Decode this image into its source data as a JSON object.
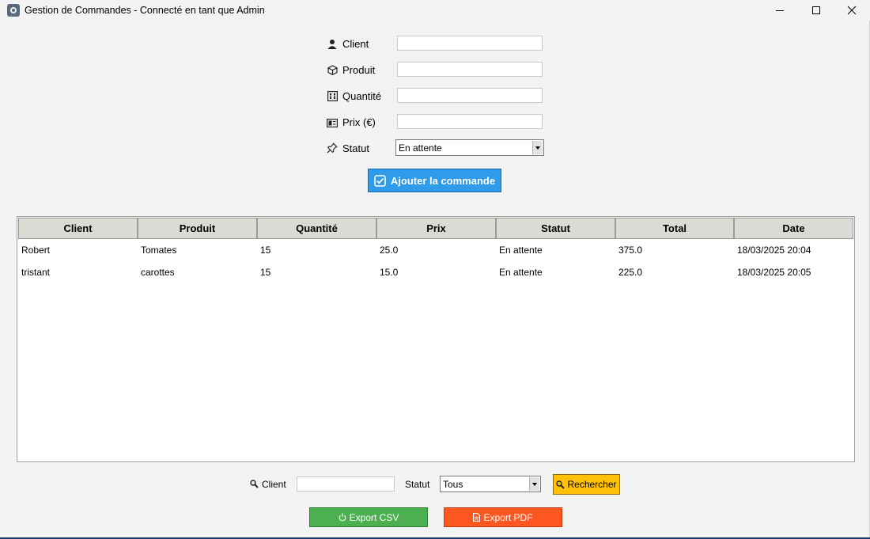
{
  "window": {
    "title": "Gestion de Commandes - Connecté en tant que Admin",
    "controls": [
      "minimize-icon",
      "maximize-icon",
      "close-icon"
    ]
  },
  "form": {
    "fields": [
      {
        "label": "Client",
        "icon": "person-icon",
        "value": ""
      },
      {
        "label": "Produit",
        "icon": "package-icon",
        "value": ""
      },
      {
        "label": "Quantité",
        "icon": "abacus-icon",
        "value": ""
      },
      {
        "label": "Prix (€)",
        "icon": "money-icon",
        "value": ""
      }
    ],
    "status": {
      "label": "Statut",
      "icon": "pushpin-icon",
      "selected": "En attente"
    },
    "add_button": {
      "label": "Ajouter la commande",
      "icon": "checkbox-icon"
    }
  },
  "table": {
    "columns": [
      "Client",
      "Produit",
      "Quantité",
      "Prix",
      "Statut",
      "Total",
      "Date"
    ],
    "rows": [
      [
        "Robert",
        "Tomates",
        "15",
        "25.0",
        "En attente",
        "375.0",
        "18/03/2025 20:04"
      ],
      [
        "tristant",
        "carottes",
        "15",
        "15.0",
        "En attente",
        "225.0",
        "18/03/2025 20:05"
      ]
    ]
  },
  "search": {
    "client_label": "Client",
    "client_icon": "magnifier-icon",
    "client_value": "",
    "status_label": "Statut",
    "status_selected": "Tous",
    "button_label": "Rechercher"
  },
  "export": {
    "csv_label": "Export CSV",
    "pdf_label": "Export PDF"
  },
  "colors": {
    "add_button": "#2f9be9",
    "search_button": "#ffc107",
    "export_csv": "#4caf50",
    "export_pdf": "#ff5722",
    "header_bg": "#dcdad5"
  }
}
